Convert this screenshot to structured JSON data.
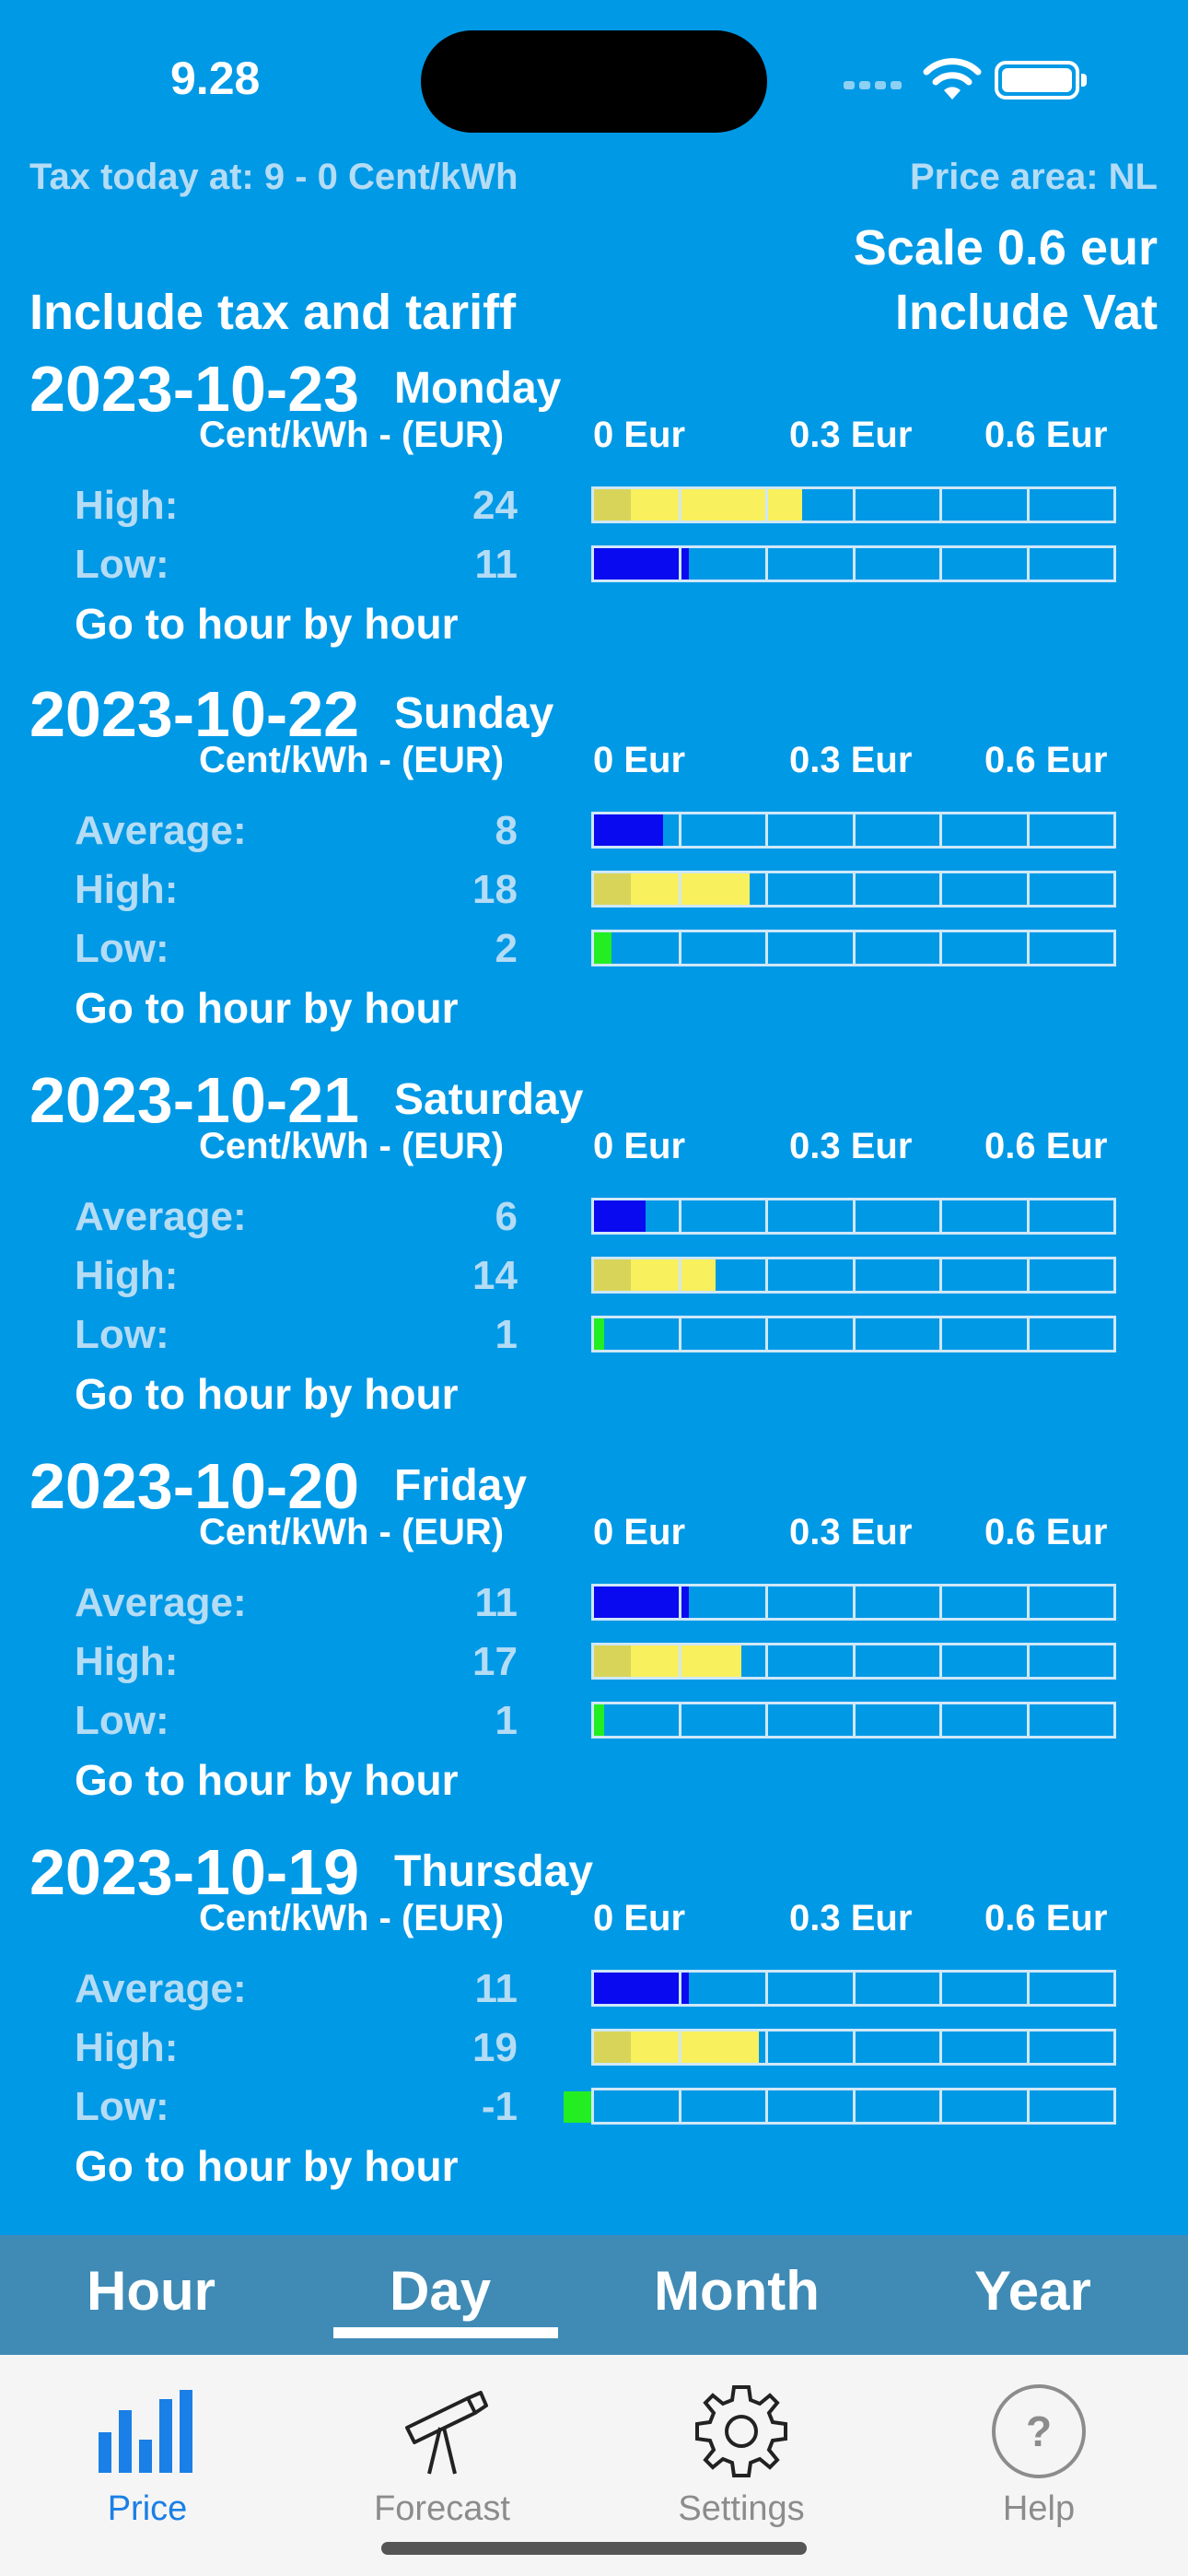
{
  "status_bar": {
    "time": "9.28"
  },
  "header": {
    "tax_today": "Tax today at: 9 - 0 Cent/kWh",
    "price_area": "Price area: NL",
    "scale": "Scale 0.6 eur",
    "include_tax": "Include tax and tariff",
    "include_vat": "Include Vat"
  },
  "axis": {
    "unit": "Cent/kWh - (EUR)",
    "scale_0": "0 Eur",
    "scale_mid": "0.3 Eur",
    "scale_max": "0.6 Eur"
  },
  "days": [
    {
      "date": "2023-10-23",
      "weekday": "Monday",
      "rows": [
        {
          "label": "High:",
          "value": "24"
        },
        {
          "label": "Low:",
          "value": "11"
        }
      ]
    },
    {
      "date": "2023-10-22",
      "weekday": "Sunday",
      "rows": [
        {
          "label": "Average:",
          "value": "8"
        },
        {
          "label": "High:",
          "value": "18"
        },
        {
          "label": "Low:",
          "value": "2"
        }
      ]
    },
    {
      "date": "2023-10-21",
      "weekday": "Saturday",
      "rows": [
        {
          "label": "Average:",
          "value": "6"
        },
        {
          "label": "High:",
          "value": "14"
        },
        {
          "label": "Low:",
          "value": "1"
        }
      ]
    },
    {
      "date": "2023-10-20",
      "weekday": "Friday",
      "rows": [
        {
          "label": "Average:",
          "value": "11"
        },
        {
          "label": "High:",
          "value": "17"
        },
        {
          "label": "Low:",
          "value": "1"
        }
      ]
    },
    {
      "date": "2023-10-19",
      "weekday": "Thursday",
      "rows": [
        {
          "label": "Average:",
          "value": "11"
        },
        {
          "label": "High:",
          "value": "19"
        },
        {
          "label": "Low:",
          "value": "-1"
        }
      ]
    }
  ],
  "go_to_hour_label": "Go to hour by hour",
  "segments": {
    "hour": "Hour",
    "day": "Day",
    "month": "Month",
    "year": "Year",
    "selected": "Day"
  },
  "tabs": {
    "price": "Price",
    "forecast": "Forecast",
    "settings": "Settings",
    "help": "Help",
    "active": "Price"
  },
  "colors": {
    "background": "#0099e6",
    "average_low": "#0a0af0",
    "high": "#f8f05c",
    "low_min": "#22ee22",
    "active_tab": "#1a7fe6"
  }
}
